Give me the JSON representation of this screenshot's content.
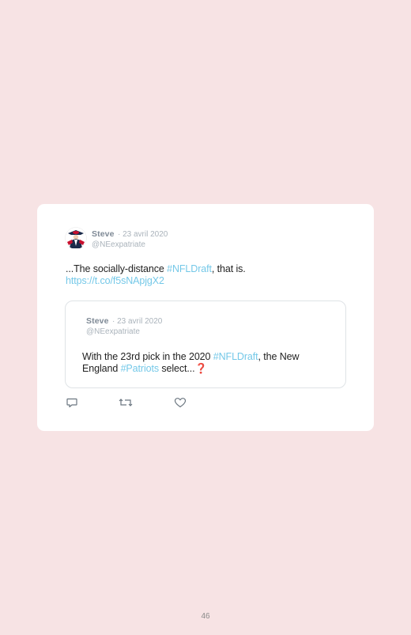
{
  "tweet": {
    "author_name": "Steve",
    "date": "· 23 avril 2020",
    "handle": "@NEexpatriate",
    "text_before": "...The socially-distance ",
    "hashtag": "#NFLDraft",
    "text_after": ", that is.",
    "url": "https://t.co/f5sNApjgX2"
  },
  "quoted": {
    "author_name": "Steve",
    "date": "· 23 avril 2020",
    "handle": "@NEexpatriate",
    "text_1": "With the 23rd pick in the 2020 ",
    "hashtag_1": "#NFLDraft",
    "text_2": ", the New England ",
    "hashtag_2": "#Patriots",
    "text_3": " select...",
    "emoji": "❓"
  },
  "actions": {
    "icons": [
      "reply-icon",
      "retweet-icon",
      "like-icon"
    ]
  },
  "page_number": "46",
  "colors": {
    "background": "#f7e3e4",
    "card": "#ffffff",
    "link": "#74c8e8",
    "muted": "#aab3bb"
  }
}
